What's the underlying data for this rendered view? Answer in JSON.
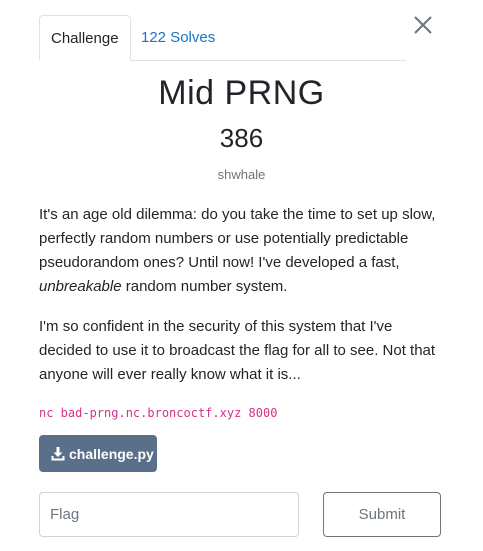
{
  "tabs": [
    {
      "label": "Challenge",
      "active": true
    },
    {
      "label": "122 Solves",
      "active": false
    }
  ],
  "close_icon": "close-icon",
  "challenge": {
    "title": "Mid PRNG",
    "value": "386",
    "author": "shwhale",
    "description_p1_a": "It's an age old dilemma: do you take the time to set up slow, perfectly random numbers or use potentially predictable pseudorandom ones? Until now! I've developed a fast, ",
    "description_p1_em": "unbreakable",
    "description_p1_b": " random number system.",
    "description_p2": "I'm so confident in the security of this system that I've decided to use it to broadcast the flag for all to see. Not that anyone will ever really know what it is...",
    "connection": "nc bad-prng.nc.broncoctf.xyz 8000",
    "file_label": "challenge.py",
    "file_icon": "download-icon"
  },
  "form": {
    "flag_placeholder": "Flag",
    "flag_value": "",
    "submit_label": "Submit"
  },
  "colors": {
    "link": "#1a73c8",
    "code": "#d63384",
    "file_button": "#5a6f8a",
    "muted": "#6c757d"
  }
}
